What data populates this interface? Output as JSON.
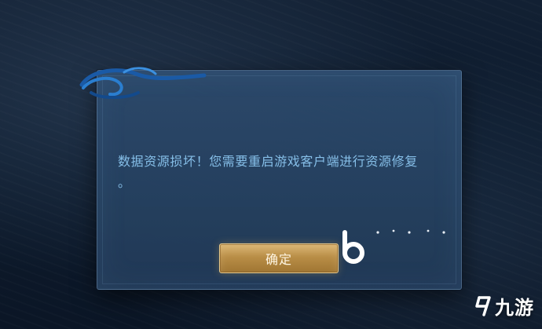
{
  "dialog": {
    "message": "数据资源损坏！您需要重启游戏客户端进行资源修复\n。",
    "confirm_label": "确定"
  },
  "watermark": {
    "text": "九游",
    "icon": "9-logo-icon"
  },
  "colors": {
    "dialog_bg": "#2c4a6c",
    "message_text": "#86bfe8",
    "button_gold": "#c8a058"
  }
}
